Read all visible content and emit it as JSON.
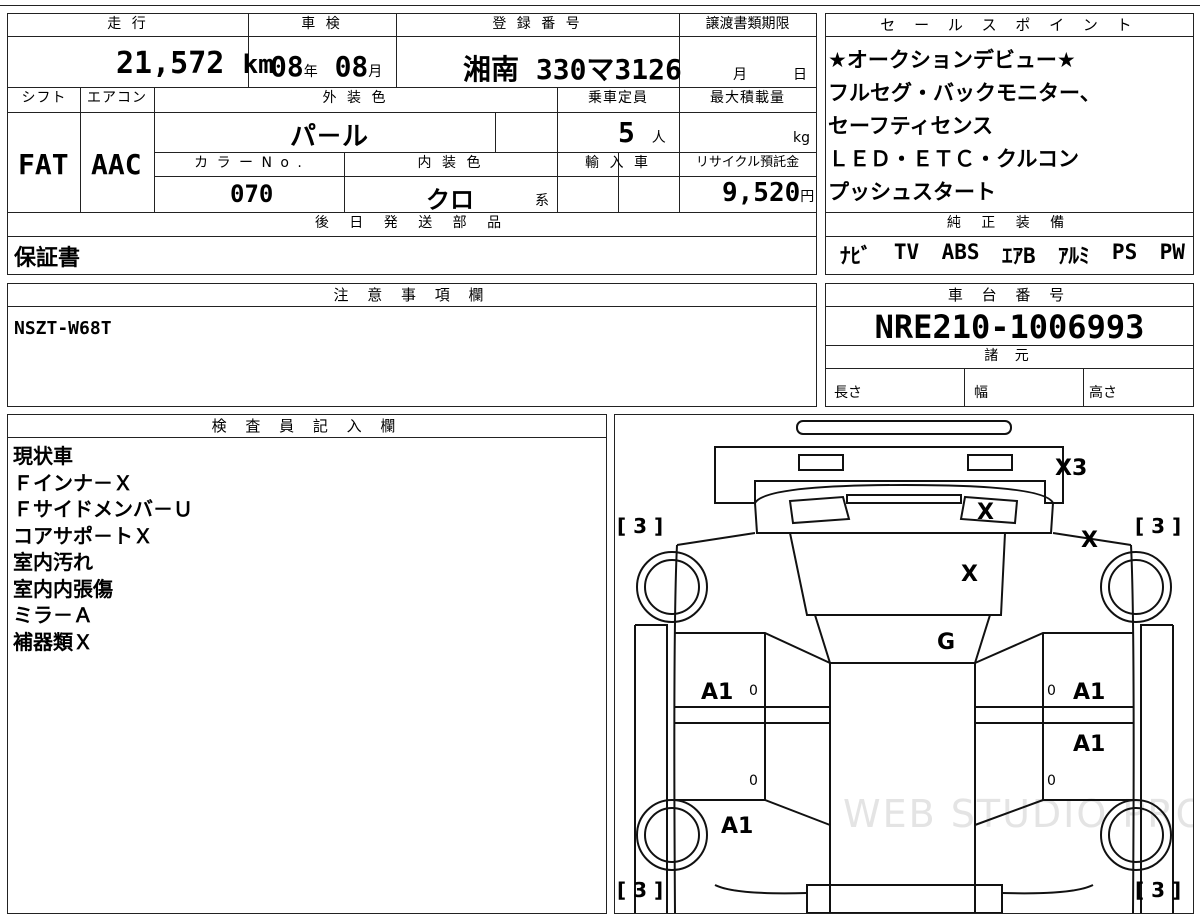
{
  "headers": {
    "mileage": "走 行",
    "inspection": "車 検",
    "registration": "登 録 番 号",
    "transfer_deadline": "譲渡書類期限",
    "shift": "シフト",
    "aircon": "エアコン",
    "exterior_color": "外 装 色",
    "capacity": "乗車定員",
    "max_load": "最大積載量",
    "color_no": "カ ラ ー N o .",
    "interior_color": "内 装 色",
    "import": "輸 入 車",
    "recycle": "リサイクル預託金",
    "later_parts": "後 日 発 送 部 品",
    "sales_points": "セ ー ル ス ポ イ ン ト",
    "genuine_equipment": "純 正 装 備",
    "notes": "注 意 事 項 欄",
    "chassis_number": "車 台 番 号",
    "specs": "諸 元",
    "inspector": "検 査 員 記 入 欄"
  },
  "vehicle": {
    "mileage": "21,572",
    "mileage_unit": "km",
    "inspection_year": "08",
    "year_unit": "年",
    "inspection_month": "08",
    "month_unit": "月",
    "registration": "湘南 330マ3126",
    "deadline_month": "月",
    "deadline_day": "日",
    "shift": "FAT",
    "aircon": "AAC",
    "exterior_color": "パ－ル",
    "capacity": "5",
    "capacity_unit": "人",
    "load_unit": "kg",
    "color_no": "070",
    "interior_color": "クロ",
    "interior_suffix": "系",
    "recycle_fee": "9,520",
    "recycle_unit": "円",
    "later_parts": "保証書",
    "sales_points": [
      "★オークションデビュー★",
      "フルセグ・バックモニター、",
      "セーフティセンス",
      "ＬＥＤ・ＥＴＣ・クルコン",
      "プッシュスタート"
    ],
    "equipment": [
      "ﾅﾋﾞ",
      "TV",
      "ABS",
      "ｴｱB",
      "ｱﾙﾐ",
      "PS",
      "PW"
    ],
    "notes": "NSZT-W68T",
    "chassis_number": "NRE210-1006993",
    "spec_length": "長さ",
    "spec_width": "幅",
    "spec_height": "高さ",
    "inspector_notes": [
      "現状車",
      "Ｆインナ－Ｘ",
      "Ｆサイドメンバ－Ｕ",
      "コアサポ－トＸ",
      "室内汚れ",
      "室内内張傷",
      "ミラ－Ａ",
      "補器類Ｘ"
    ]
  },
  "diagram": {
    "marks": {
      "rear_x3": "X3",
      "trunk_x": "X",
      "rear_side_x": "X",
      "roof_x": "X",
      "glass_g": "G",
      "left_door_a1": "A1",
      "right_front_door_a1": "A1",
      "right_rear_door_a1": "A1",
      "left_fender_a1": "A1"
    },
    "tires": {
      "top_left": "[ 3 ]",
      "top_right": "[ 3 ]",
      "bottom_left": "[ 3 ]",
      "bottom_right": "[ 3 ]"
    },
    "small_zeros": [
      "0",
      "0",
      "0",
      "0"
    ],
    "watermark": "WEB STUDIO PRO"
  }
}
